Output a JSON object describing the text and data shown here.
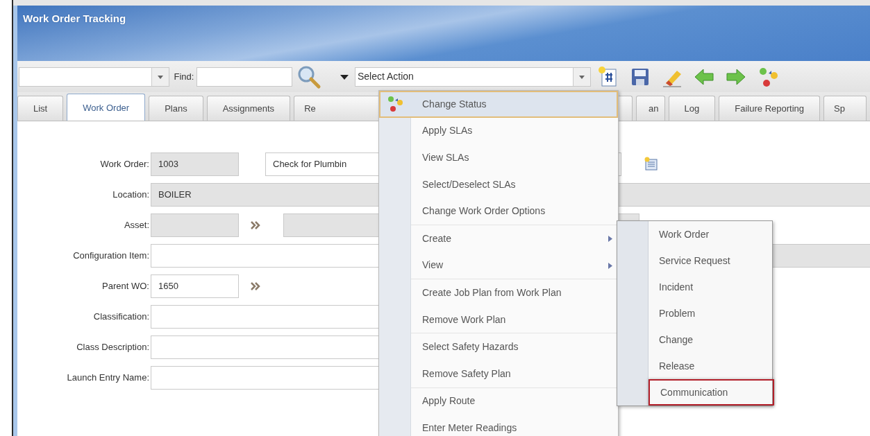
{
  "app_title": "Work Order Tracking",
  "toolbar": {
    "find_label": "Find:",
    "action_select": {
      "value": "Select Action"
    }
  },
  "tabs": [
    {
      "label": "List",
      "selected": false,
      "kind": "full"
    },
    {
      "label": "Work Order",
      "selected": true,
      "kind": "full"
    },
    {
      "label": "Plans",
      "selected": false,
      "kind": "full"
    },
    {
      "label": "Assignments",
      "selected": false,
      "kind": "full"
    },
    {
      "label": "Re",
      "selected": false,
      "kind": "clipped_end"
    },
    {
      "label": "an",
      "selected": false,
      "kind": "clipped_start"
    },
    {
      "label": "Log",
      "selected": false,
      "kind": "full"
    },
    {
      "label": "Failure Reporting",
      "selected": false,
      "kind": "full"
    },
    {
      "label": "Sp",
      "selected": false,
      "kind": "clipped_end"
    }
  ],
  "form_rows": [
    {
      "label": "Work Order:",
      "parts": [
        {
          "kind": "short",
          "readonly": true,
          "value": "1003"
        },
        {
          "kind": "gap"
        },
        {
          "kind": "medium",
          "readonly": false,
          "value": "Check for Plumbin"
        },
        {
          "kind": "detail_icon"
        }
      ]
    },
    {
      "label": "Location:",
      "parts": [
        {
          "kind": "long",
          "readonly": true,
          "value": "BOILER"
        }
      ]
    },
    {
      "label": "Asset:",
      "parts": [
        {
          "kind": "short",
          "readonly": true
        },
        {
          "kind": "chevron"
        },
        {
          "kind": "medium",
          "readonly": true
        }
      ]
    },
    {
      "label": "Configuration Item:",
      "parts": [
        {
          "kind": "half",
          "readonly": false
        },
        {
          "kind": "rest",
          "readonly": true
        }
      ]
    },
    {
      "label": "Parent WO:",
      "parts": [
        {
          "kind": "short",
          "readonly": false,
          "value": "1650"
        },
        {
          "kind": "chevron"
        }
      ]
    },
    {
      "label": "Classification:",
      "parts": [
        {
          "kind": "half",
          "readonly": false
        }
      ]
    },
    {
      "label": "Class Description:",
      "parts": [
        {
          "kind": "half",
          "readonly": false
        }
      ]
    },
    {
      "label": "Launch Entry Name:",
      "parts": [
        {
          "kind": "half",
          "readonly": false
        }
      ]
    }
  ],
  "action_menu": {
    "groups": [
      [
        {
          "label": "Change Status",
          "selected": true,
          "has_submenu": false
        },
        {
          "label": "Apply SLAs",
          "selected": false,
          "has_submenu": false
        },
        {
          "label": "View SLAs",
          "selected": false,
          "has_submenu": false
        },
        {
          "label": "Select/Deselect SLAs",
          "selected": false,
          "has_submenu": false
        },
        {
          "label": "Change Work Order Options",
          "selected": false,
          "has_submenu": false
        }
      ],
      [
        {
          "label": "Create",
          "selected": false,
          "has_submenu": true,
          "children": [
            {
              "label": "Work Order",
              "highlighted": false
            },
            {
              "label": "Service Request",
              "highlighted": false
            },
            {
              "label": "Incident",
              "highlighted": false
            },
            {
              "label": "Problem",
              "highlighted": false
            },
            {
              "label": "Change",
              "highlighted": false
            },
            {
              "label": "Release",
              "highlighted": false
            },
            {
              "label": "Communication",
              "highlighted": true
            }
          ]
        },
        {
          "label": "View",
          "selected": false,
          "has_submenu": true
        }
      ],
      [
        {
          "label": "Create Job Plan from Work Plan",
          "selected": false,
          "has_submenu": false
        },
        {
          "label": "Remove Work Plan",
          "selected": false,
          "has_submenu": false
        }
      ],
      [
        {
          "label": "Select Safety Hazards",
          "selected": false,
          "has_submenu": false
        },
        {
          "label": "Remove Safety Plan",
          "selected": false,
          "has_submenu": false
        }
      ],
      [
        {
          "label": "Apply Route",
          "selected": false,
          "has_submenu": false
        },
        {
          "label": "Enter Meter Readings",
          "selected": false,
          "has_submenu": false
        }
      ]
    ]
  }
}
